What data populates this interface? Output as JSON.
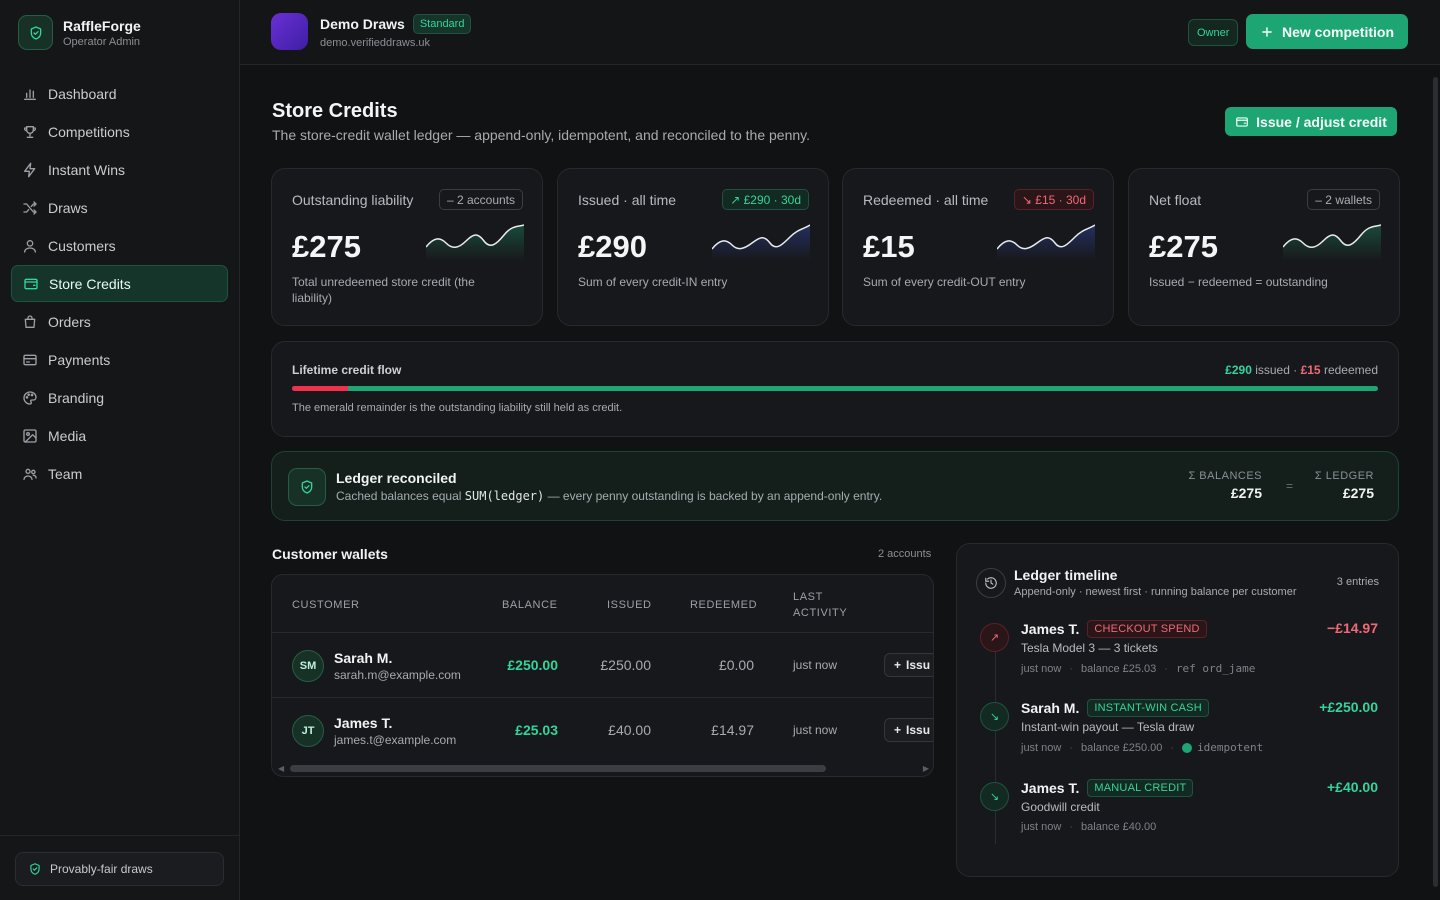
{
  "brand": {
    "name": "RaffleForge",
    "subtitle": "Operator Admin",
    "icon": "shield-check-icon"
  },
  "nav": [
    {
      "label": "Dashboard",
      "icon": "bar-chart-icon",
      "active": false
    },
    {
      "label": "Competitions",
      "icon": "trophy-icon",
      "active": false
    },
    {
      "label": "Instant Wins",
      "icon": "lightning-icon",
      "active": false
    },
    {
      "label": "Draws",
      "icon": "shuffle-icon",
      "active": false
    },
    {
      "label": "Customers",
      "icon": "user-icon",
      "active": false
    },
    {
      "label": "Store Credits",
      "icon": "wallet-icon",
      "active": true
    },
    {
      "label": "Orders",
      "icon": "bag-icon",
      "active": false
    },
    {
      "label": "Payments",
      "icon": "card-icon",
      "active": false
    },
    {
      "label": "Branding",
      "icon": "palette-icon",
      "active": false
    },
    {
      "label": "Media",
      "icon": "image-icon",
      "active": false
    },
    {
      "label": "Team",
      "icon": "users-icon",
      "active": false
    }
  ],
  "sidebar_footer": {
    "label": "Provably-fair draws"
  },
  "tenant": {
    "name": "Demo Draws",
    "plan": "Standard",
    "domain": "demo.verifieddraws.uk"
  },
  "topbar": {
    "role": "Owner",
    "new_button": "New competition"
  },
  "page": {
    "title": "Store Credits",
    "subtitle": "The store-credit wallet ledger — append-only, idempotent, and reconciled to the penny.",
    "issue_button": "Issue / adjust credit"
  },
  "stats": [
    {
      "label": "Outstanding liability",
      "badge": "– 2 accounts",
      "trend": "neutral",
      "value": "£275",
      "desc": "Total unredeemed store credit (the liability)"
    },
    {
      "label": "Issued · all time",
      "badge": "↗ £290 · 30d",
      "trend": "up",
      "value": "£290",
      "desc": "Sum of every credit-IN entry"
    },
    {
      "label": "Redeemed · all time",
      "badge": "↘ £15 · 30d",
      "trend": "down",
      "value": "£15",
      "desc": "Sum of every credit-OUT entry"
    },
    {
      "label": "Net float",
      "badge": "– 2 wallets",
      "trend": "neutral",
      "value": "£275",
      "desc": "Issued − redeemed = outstanding"
    }
  ],
  "flow": {
    "title": "Lifetime credit flow",
    "issued": "£290",
    "issued_word": "issued",
    "redeemed": "£15",
    "redeemed_word": "redeemed",
    "redeemed_fraction": 0.0517,
    "note": "The emerald remainder is the outstanding liability still held as credit."
  },
  "reconciled": {
    "title": "Ledger reconciled",
    "sub_before": "Cached balances equal ",
    "sub_code": "SUM(ledger)",
    "sub_after": " — every penny outstanding is backed by an append-only entry.",
    "balances_label": "Σ BALANCES",
    "balances_value": "£275",
    "eq": "=",
    "ledger_label": "Σ LEDGER",
    "ledger_value": "£275"
  },
  "wallets": {
    "title": "Customer wallets",
    "count": "2 accounts",
    "headers": {
      "customer": "CUSTOMER",
      "balance": "BALANCE",
      "issued": "ISSUED",
      "redeemed": "REDEEMED",
      "activity_1": "LAST",
      "activity_2": "ACTIVITY"
    },
    "rows": [
      {
        "initials": "SM",
        "name": "Sarah M.",
        "email": "sarah.m@example.com",
        "balance": "£250.00",
        "issued": "£250.00",
        "redeemed": "£0.00",
        "activity": "just now",
        "action": "Issu"
      },
      {
        "initials": "JT",
        "name": "James T.",
        "email": "james.t@example.com",
        "balance": "£25.03",
        "issued": "£40.00",
        "redeemed": "£14.97",
        "activity": "just now",
        "action": "Issu"
      }
    ]
  },
  "timeline": {
    "title": "Ledger timeline",
    "subtitle": "Append-only · newest first · running balance per customer",
    "count": "3 entries",
    "entries": [
      {
        "direction": "out",
        "name": "James T.",
        "tag": "CHECKOUT SPEND",
        "amount": "−£14.97",
        "desc": "Tesla Model 3 — 3 tickets",
        "time": "just now",
        "balance": "balance £25.03",
        "extra": "ref ord_jame"
      },
      {
        "direction": "in",
        "name": "Sarah M.",
        "tag": "INSTANT-WIN CASH",
        "amount": "+£250.00",
        "desc": "Instant-win payout — Tesla draw",
        "time": "just now",
        "balance": "balance £250.00",
        "extra": "idempotent"
      },
      {
        "direction": "in",
        "name": "James T.",
        "tag": "MANUAL CREDIT",
        "amount": "+£40.00",
        "desc": "Goodwill credit",
        "time": "just now",
        "balance": "balance £40.00",
        "extra": ""
      }
    ]
  },
  "colors": {
    "accent": "#1ea574",
    "accent_text": "#35d49a",
    "danger": "#f06a76",
    "bg": "#111214",
    "card": "#17181b"
  }
}
